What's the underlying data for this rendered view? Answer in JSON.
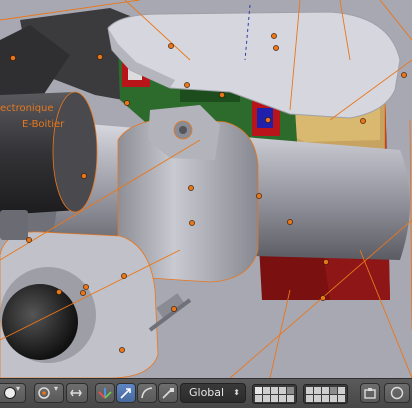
{
  "viewport": {
    "labels": [
      "ectronique",
      "E-Boitier"
    ]
  },
  "toolbar": {
    "pivot_icon": "pivot-point-icon",
    "snap_icon": "snap-magnet-icon",
    "manipulator_icons": [
      "manipulator-toggle-icon",
      "translate-icon",
      "rotate-icon",
      "scale-icon"
    ],
    "orientation_value": "Global",
    "layers_icon": "layers-grid-icon",
    "render_icons": [
      "lock-camera-icon",
      "render-preview-icon"
    ]
  },
  "colors": {
    "accent_orange": "#e8771c",
    "active_blue": "#5a80bd",
    "toolbar_bg": "#4f4f4f",
    "viewport_bg": "#a9a9b3"
  }
}
